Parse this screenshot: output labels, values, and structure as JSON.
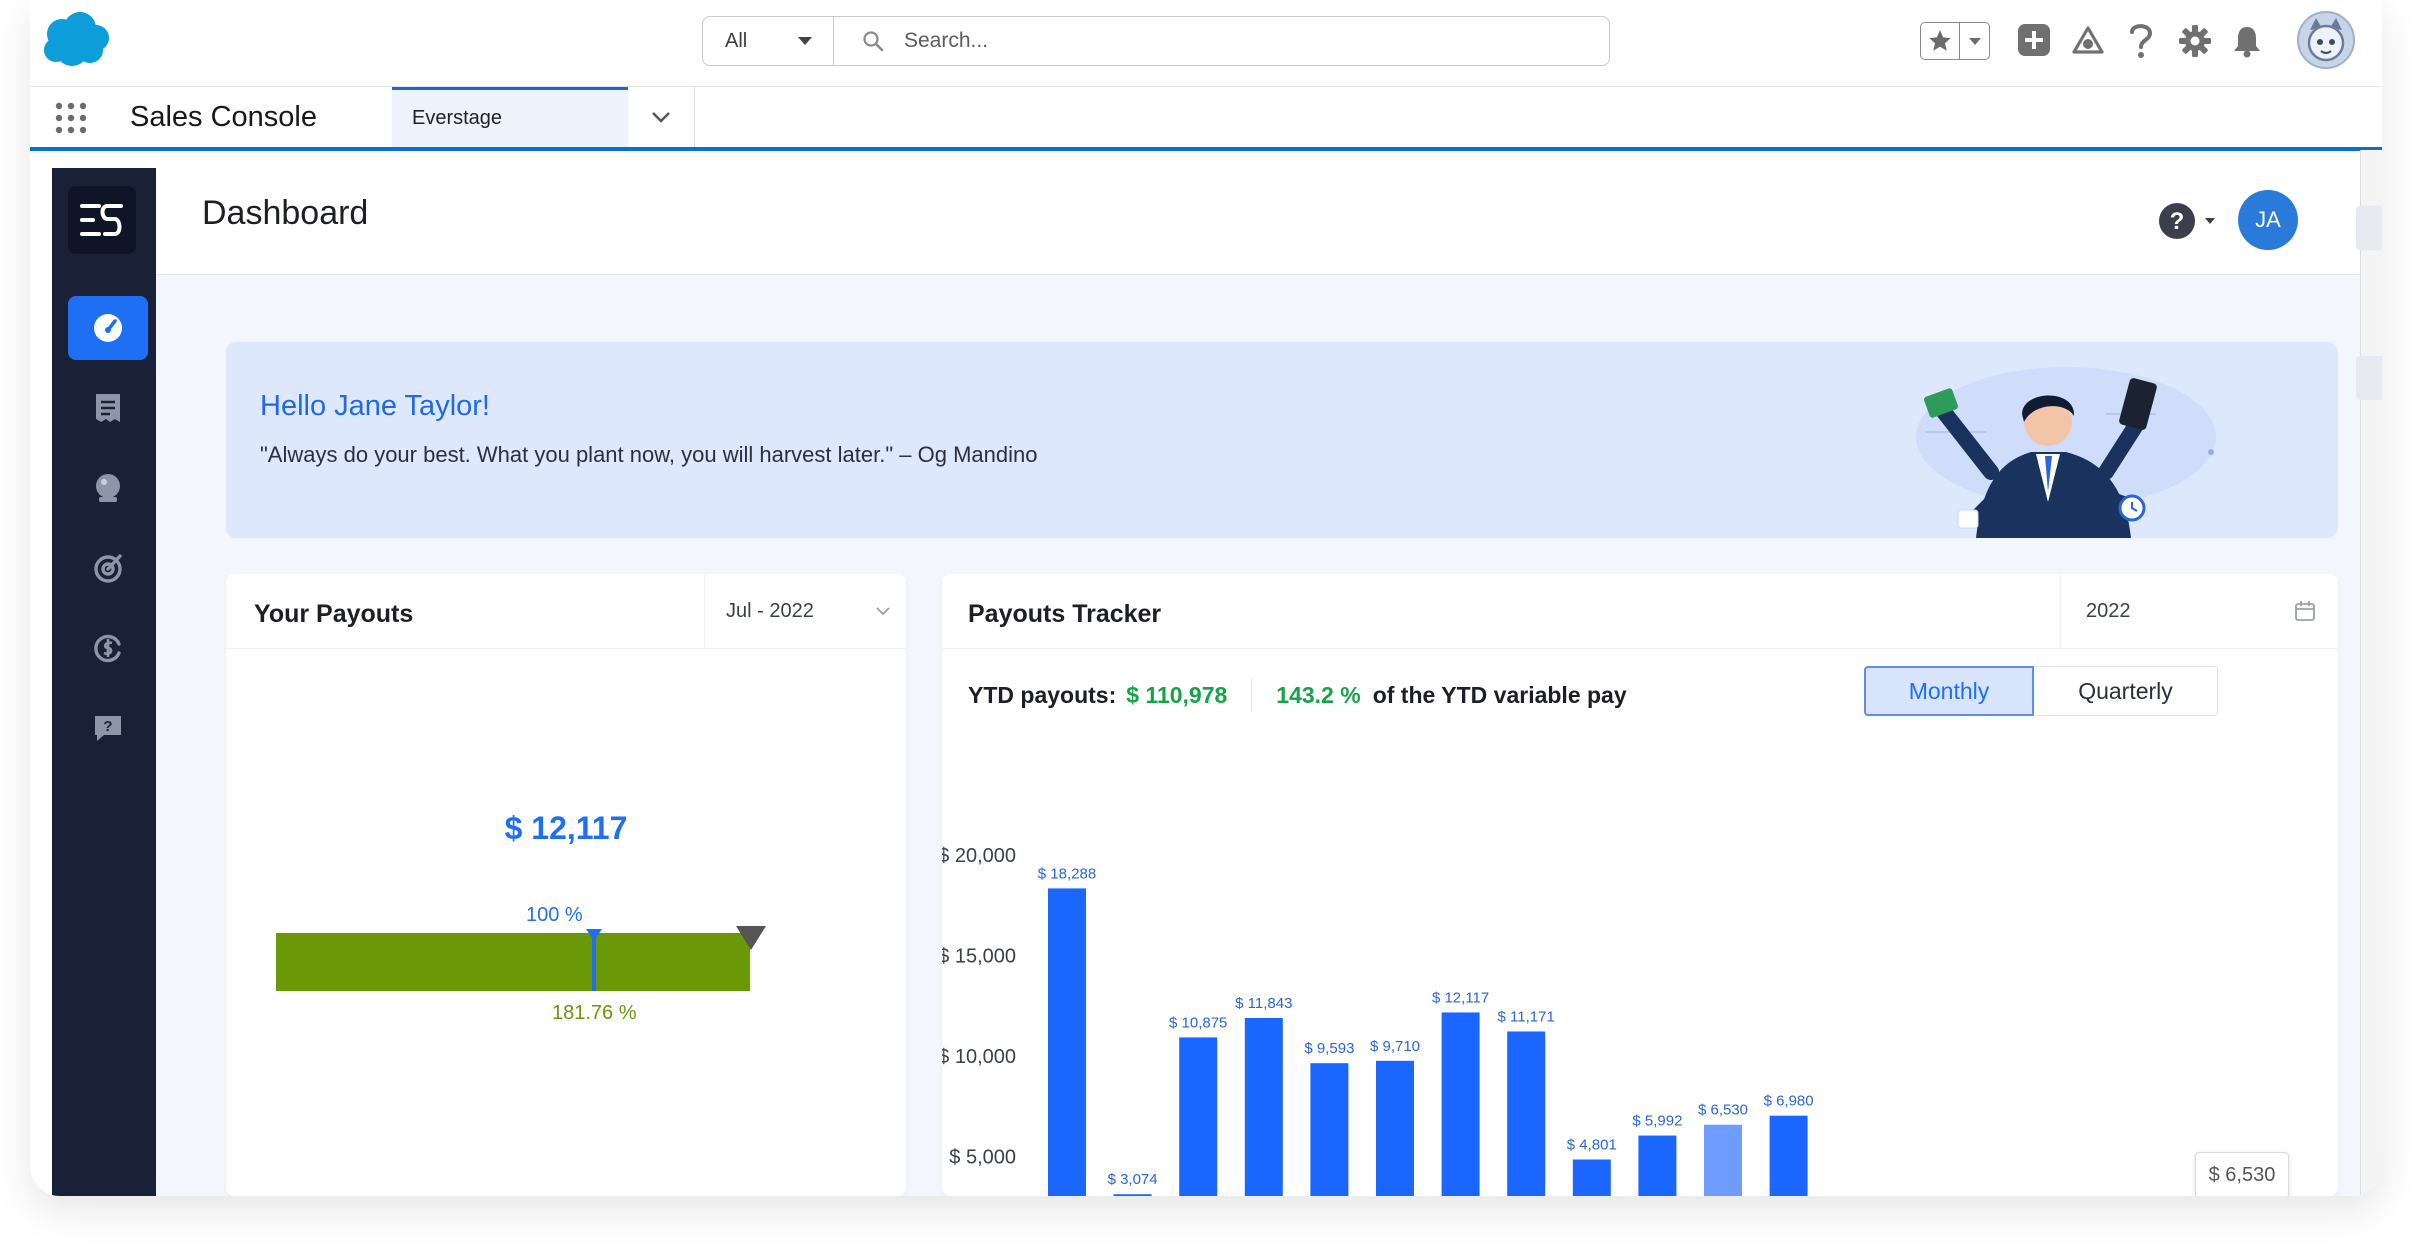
{
  "top_bar": {
    "search_scope": "All",
    "search_placeholder": "Search..."
  },
  "app_nav": {
    "app_name": "Sales Console",
    "tab_label": "Everstage"
  },
  "header": {
    "title": "Dashboard",
    "avatar_initials": "JA"
  },
  "banner": {
    "greeting": "Hello Jane Taylor!",
    "quote": "\"Always do your best. What you plant now, you will harvest later.\" – Og Mandino"
  },
  "payouts_card": {
    "title": "Your Payouts",
    "period": "Jul - 2022",
    "amount": "$ 12,117",
    "target_label": "100 %",
    "attainment_label": "181.76 %",
    "attainment_percent": 181.76
  },
  "tracker_card": {
    "title": "Payouts Tracker",
    "year": "2022",
    "ytd_label": "YTD payouts:",
    "ytd_value": "$ 110,978",
    "ytd_percent": "143.2 %",
    "ytd_suffix": "of the YTD variable pay",
    "toggle_monthly": "Monthly",
    "toggle_quarterly": "Quarterly",
    "tooltip": "$ 6,530"
  },
  "colors": {
    "accent": "#1f6ff5",
    "bar": "#1a66ff",
    "bar_highlight": "#6f9dff",
    "progress_green": "#6a9806",
    "success_green": "#16a34a",
    "sidebar": "#1a2035",
    "banner_bg": "#dde8fd"
  },
  "chart_data": {
    "type": "bar",
    "title": "",
    "xlabel": "",
    "ylabel": "",
    "values": [
      18288,
      3074,
      10875,
      11843,
      9593,
      9710,
      12117,
      11171,
      4801,
      5992,
      6530,
      6980
    ],
    "data_labels": [
      "$ 18,288",
      "$ 3,074",
      "$ 10,875",
      "$ 11,843",
      "$ 9,593",
      "$ 9,710",
      "$ 12,117",
      "$ 11,171",
      "$ 4,801",
      "$ 5,992",
      "$ 6,530",
      "$ 6,980"
    ],
    "highlighted_index": 10,
    "y_ticks": [
      5000,
      10000,
      15000,
      20000
    ],
    "y_tick_labels": [
      "$ 5,000",
      "$ 10,000",
      "$ 15,000",
      "$ 20,000"
    ],
    "ylim": [
      0,
      20000
    ],
    "grid": false
  }
}
